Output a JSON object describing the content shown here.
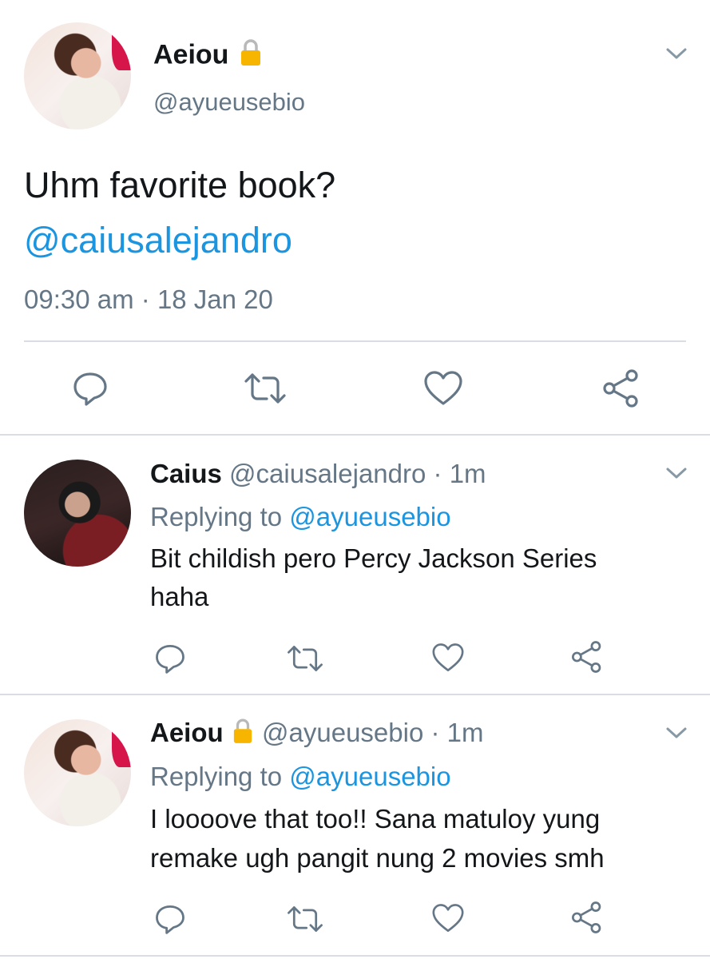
{
  "main_tweet": {
    "author_name": "Aeiou",
    "author_handle": "@ayueusebio",
    "text": "Uhm favorite book?",
    "mention": "@caiusalejandro",
    "time": "09:30 am",
    "separator": "·",
    "date": "18 Jan 20"
  },
  "replies": [
    {
      "name": "Caius",
      "handle": "@caiusalejandro",
      "sep": "·",
      "time": "1m",
      "replying_label": "Replying to",
      "replying_handle": "@ayueusebio",
      "text_line1": "Bit childish pero Percy Jackson Series",
      "text_line2": "haha"
    },
    {
      "name": "Aeiou",
      "handle": "@ayueusebio",
      "sep": "·",
      "time": "1m",
      "replying_label": "Replying to",
      "replying_handle": "@ayueusebio",
      "text_line1": "I loooove that too!! Sana matuloy yung",
      "text_line2": "remake ugh pangit nung 2 movies smh"
    }
  ],
  "icons": [
    "chevron-down-icon",
    "lock-icon",
    "reply-icon",
    "retweet-icon",
    "like-icon",
    "share-icon"
  ],
  "colors": {
    "link": "#1b95e0",
    "muted": "#657786",
    "text": "#14171a",
    "lock": "#f7b500"
  }
}
